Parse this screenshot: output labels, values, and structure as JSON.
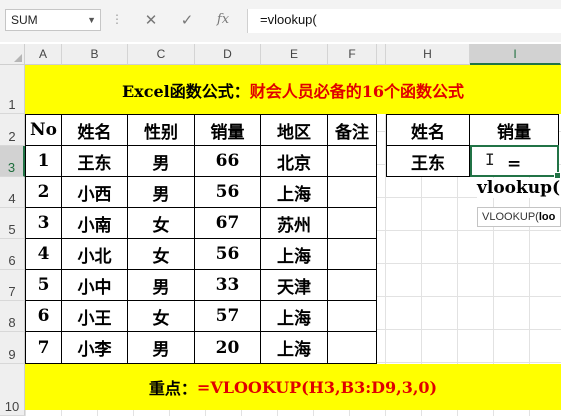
{
  "formula_bar": {
    "name_box": "SUM",
    "cancel_icon": "✕",
    "enter_icon": "✓",
    "function_icon": "fx",
    "formula": "=vlookup("
  },
  "columns": [
    "A",
    "B",
    "C",
    "D",
    "E",
    "F",
    "G",
    "H",
    "I"
  ],
  "rows": [
    "1",
    "2",
    "3",
    "4",
    "5",
    "6",
    "7",
    "8",
    "9",
    "10"
  ],
  "title": {
    "black": "Excel函数公式：",
    "red": "财会人员必备的16个函数公式"
  },
  "table": {
    "headers": [
      "No",
      "姓名",
      "性别",
      "销量",
      "地区",
      "备注"
    ],
    "rows": [
      [
        "1",
        "王东",
        "男",
        "66",
        "北京",
        ""
      ],
      [
        "2",
        "小西",
        "男",
        "56",
        "上海",
        ""
      ],
      [
        "3",
        "小南",
        "女",
        "67",
        "苏州",
        ""
      ],
      [
        "4",
        "小北",
        "女",
        "56",
        "上海",
        ""
      ],
      [
        "5",
        "小中",
        "男",
        "33",
        "天津",
        ""
      ],
      [
        "6",
        "小王",
        "女",
        "57",
        "上海",
        ""
      ],
      [
        "7",
        "小李",
        "男",
        "20",
        "上海",
        ""
      ]
    ]
  },
  "lookup": {
    "header_name": "姓名",
    "header_sales": "销量",
    "name_value": "王东",
    "edit_eq": "=",
    "edit_text": "vlookup("
  },
  "tooltip": {
    "fn": "VLOOKUP(",
    "arg": "loo"
  },
  "footer": {
    "black": "重点：",
    "red": "=VLOOKUP(H3,B3:D9,3,0)"
  },
  "colors": {
    "banner": "#ffff00",
    "red_text": "#e00000",
    "excel_green": "#217346"
  }
}
